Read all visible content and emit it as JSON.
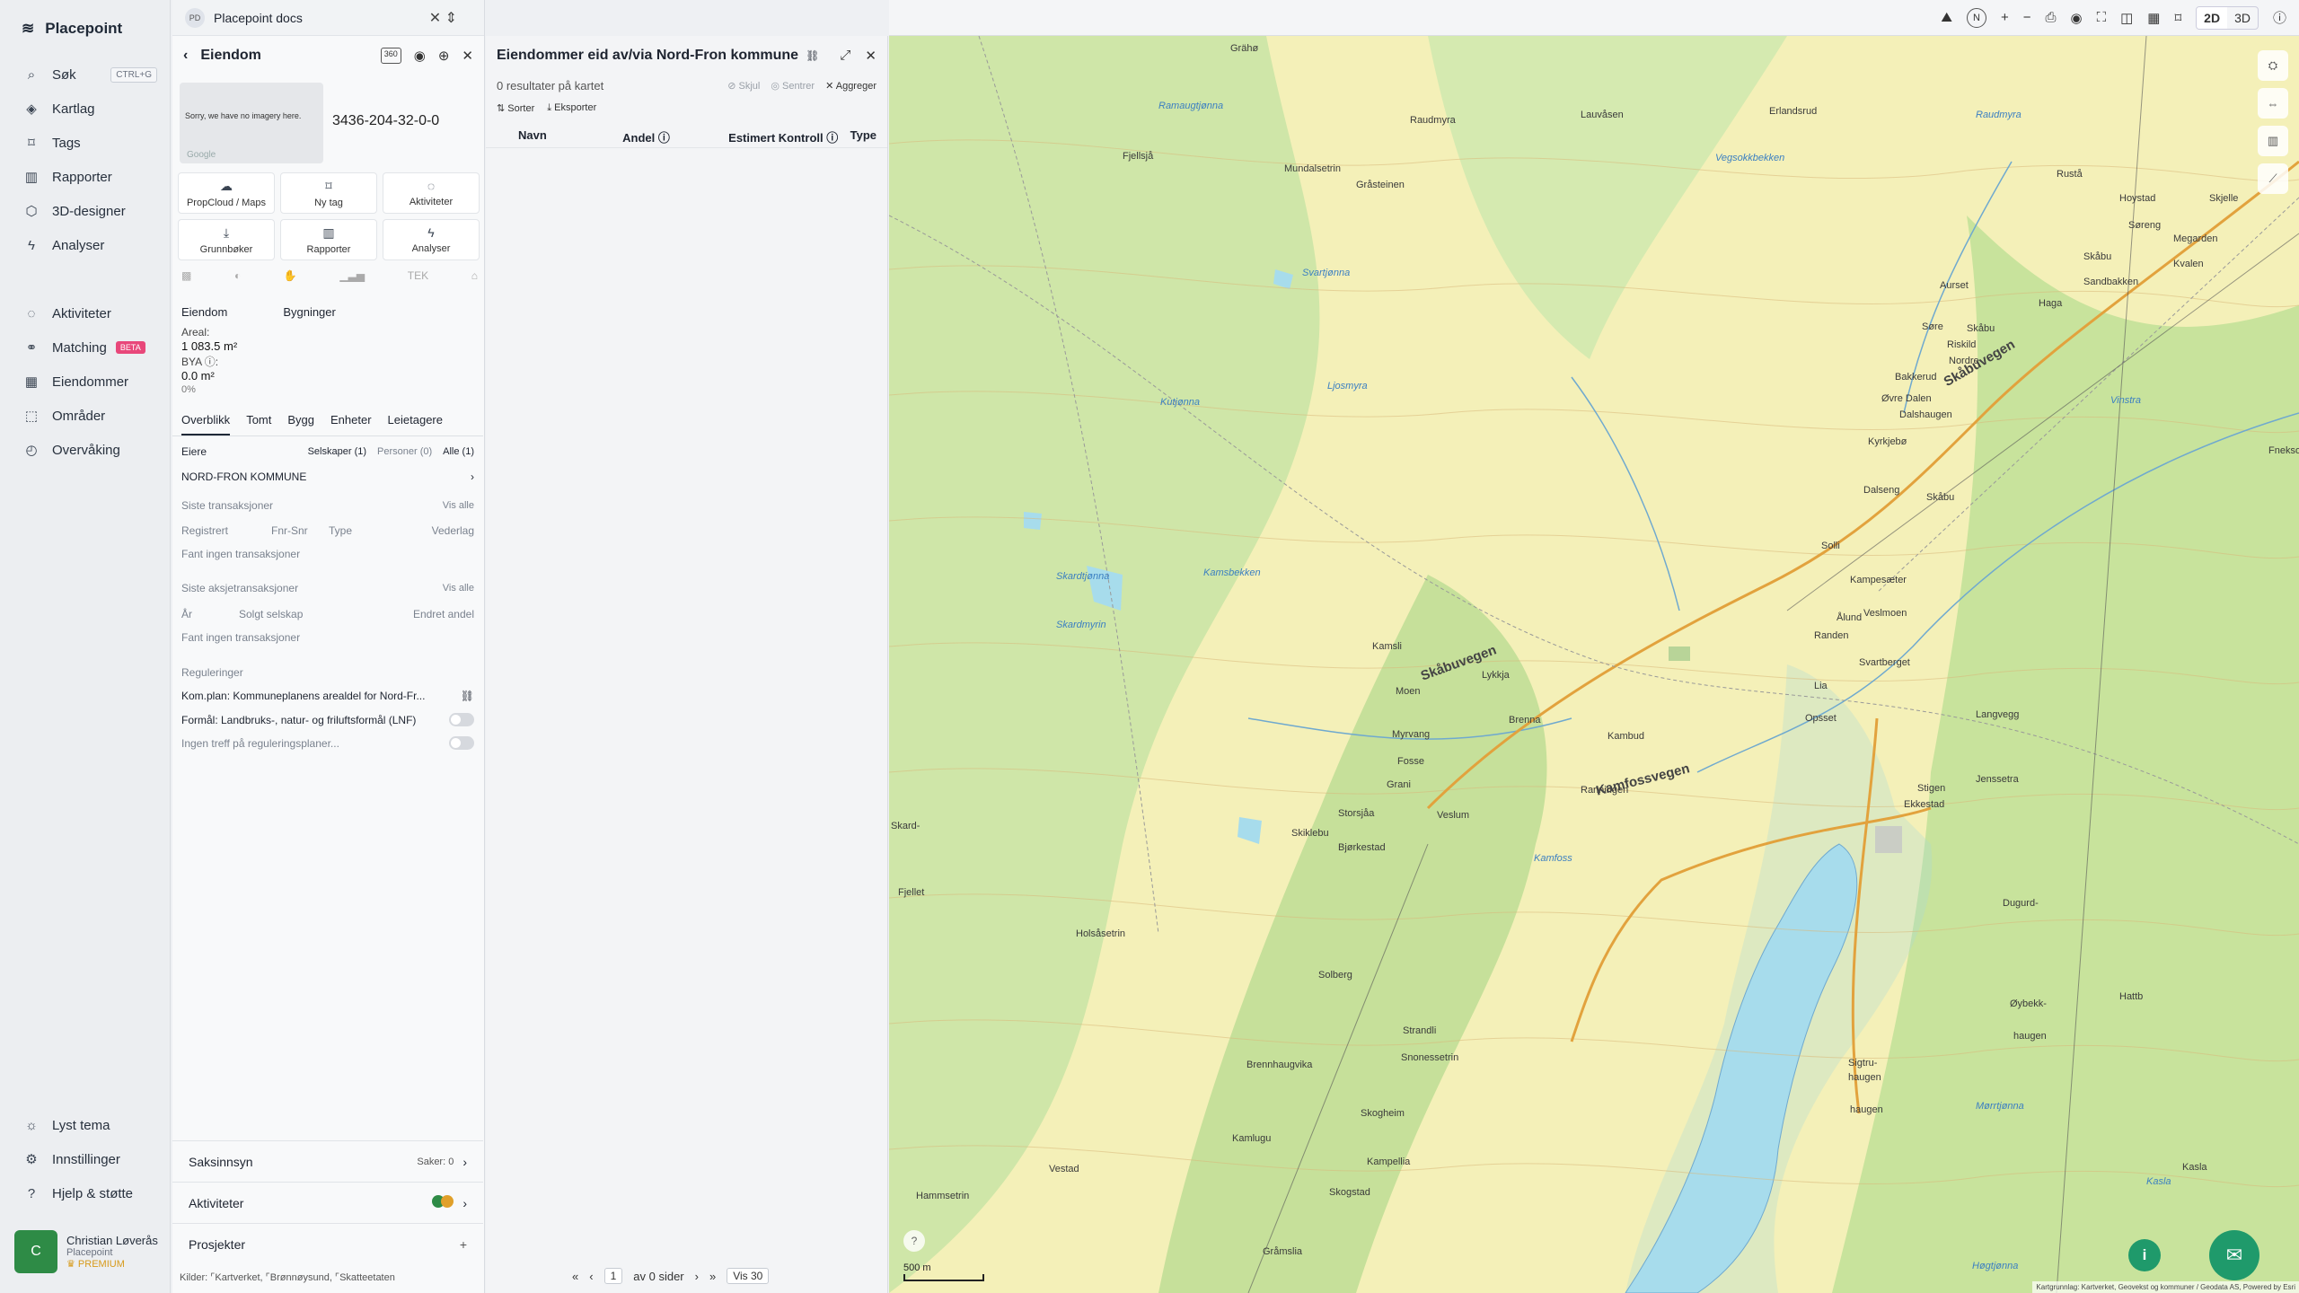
{
  "app": {
    "name": "Placepoint"
  },
  "sidebar": {
    "search": {
      "label": "Søk",
      "shortcut": "CTRL+G"
    },
    "items": [
      {
        "label": "Kartlag",
        "icon": "layers-icon"
      },
      {
        "label": "Tags",
        "icon": "bookmark-icon"
      },
      {
        "label": "Rapporter",
        "icon": "chart-icon"
      },
      {
        "label": "3D-designer",
        "icon": "cube-icon"
      },
      {
        "label": "Analyser",
        "icon": "bolt-icon"
      }
    ],
    "items2": [
      {
        "label": "Aktiviteter"
      },
      {
        "label": "Matching",
        "badge": "BETA"
      },
      {
        "label": "Eiendommer"
      },
      {
        "label": "Områder"
      },
      {
        "label": "Overvåking"
      }
    ],
    "bottom": [
      {
        "label": "Lyst tema"
      },
      {
        "label": "Innstillinger"
      },
      {
        "label": "Hjelp & støtte"
      }
    ],
    "user": {
      "initial": "C",
      "name": "Christian Løverås",
      "org": "Placepoint",
      "plan": "PREMIUM"
    }
  },
  "docs": {
    "badge": "PD",
    "title": "Placepoint docs"
  },
  "property": {
    "header": "Eiendom",
    "badge_360": "360",
    "thumb_text": "Sorry, we have no imagery here.",
    "thumb_brand": "Google",
    "id": "3436-204-32-0-0",
    "tiles": [
      {
        "label": "PropCloud / Maps"
      },
      {
        "label": "Ny tag"
      },
      {
        "label": "Aktiviteter"
      },
      {
        "label": "Grunnbøker"
      },
      {
        "label": "Rapporter"
      },
      {
        "label": "Analyser"
      }
    ],
    "col_a": "Eiendom",
    "col_b": "Bygninger",
    "areal_label": "Areal:",
    "areal_value": "1 083.5 m²",
    "bya_label": "BYA ⓘ:",
    "bya_value": "0.0 m²",
    "bya_pct": "0%",
    "tabs": [
      "Overblikk",
      "Tomt",
      "Bygg",
      "Enheter",
      "Leietagere"
    ],
    "owners": {
      "label": "Eiere",
      "companies": "Selskaper (1)",
      "persons": "Personer (0)",
      "all": "Alle (1)",
      "owner": "NORD-FRON KOMMUNE"
    },
    "tx": {
      "title": "Siste transaksjoner",
      "see_all": "Vis alle",
      "cols": [
        "Registrert",
        "Fnr-Snr",
        "Type",
        "Vederlag"
      ],
      "empty": "Fant ingen transaksjoner"
    },
    "stx": {
      "title": "Siste aksjetransaksjoner",
      "see_all": "Vis alle",
      "cols": [
        "År",
        "Solgt selskap",
        "Endret andel"
      ],
      "empty": "Fant ingen transaksjoner"
    },
    "reg": {
      "title": "Reguleringer",
      "plan": "Kom.plan: Kommuneplanens arealdel for Nord-Fr...",
      "formal": "Formål: Landbruks-, natur- og friluftsformål (LNF)",
      "none": "Ingen treff på reguleringsplaner..."
    },
    "acc": [
      {
        "label": "Saksinnsyn",
        "right": "Saker: 0"
      },
      {
        "label": "Aktiviteter",
        "right": ""
      },
      {
        "label": "Prosjekter",
        "right": "+"
      }
    ],
    "kilder": "Kilder: ⌜Kartverket, ⌜Brønnøysund, ⌜Skatteetaten"
  },
  "list": {
    "title": "Eiendommer eid av/via Nord-Fron kommune",
    "results": "0 resultater på kartet",
    "actions": [
      "Skjul",
      "Sentrer",
      "Aggreger"
    ],
    "sort": "Sorter",
    "export": "Eksporter",
    "cols": [
      "Navn",
      "Andel ⓘ",
      "Estimert Kontroll ⓘ",
      "Type"
    ],
    "pager": {
      "page": "1",
      "of": "av 0 sider",
      "show": "Vis 30"
    }
  },
  "topbar": {
    "d2": "2D",
    "d3": "3D"
  },
  "map": {
    "scale": "500 m",
    "attribution": "Kartgrunnlag: Kartverket, Geovekst og kommuner / Geodata AS, Powered by Esri",
    "places": [
      "Grähø",
      "Lauvåsen",
      "Erlandsrud",
      "Raudmyra",
      "Rustå",
      "Mundalsetrin",
      "Fjellsjå",
      "Gråsteinen",
      "Hoystad",
      "Skjelle",
      "Søreng",
      "Megarden",
      "Skåbu",
      "Kvalen",
      "Sandbakken",
      "Aurset",
      "Haga",
      "Skåbu",
      "Søre",
      "Riskild",
      "Nordre",
      "Bakkerud",
      "Øvre Dalen",
      "Dalshaugen",
      "Kyrkjebø",
      "Dalseng",
      "Skåbu",
      "Solli",
      "Ålund",
      "Kampesæter",
      "Veslmoen",
      "Kamsli",
      "Lykkja",
      "Moen",
      "Brenna",
      "Kambud",
      "Lia",
      "Opsset",
      "Myrvang",
      "Fosse",
      "Grani",
      "Ranningen",
      "Randen",
      "Svartberget",
      "Langvegg",
      "Jenssetra",
      "Stigen",
      "Ekkestad",
      "Storsjåa",
      "Skiklebu",
      "Bjørkestad",
      "Veslum",
      "Skard-",
      "Fjellet",
      "Holsåsetrin",
      "Solberg",
      "Strandli",
      "Snonessetrin",
      "Brennhaugvika",
      "Skogheim",
      "Kamlugu",
      "Kampellia",
      "Skogstad",
      "Vestad",
      "Hammsetrin",
      "Gråmslia",
      "Dugurd-",
      "Øybekk-",
      "haugen",
      "Sigtru-",
      "haugen",
      "haugen",
      "Hattb",
      "Kasla",
      "Fnekso"
    ],
    "waters": [
      "Ramaugtjønna",
      "Raudmyra",
      "Vegsokkbekken",
      "Svartjønna",
      "Kutjønna",
      "Ljosmyra",
      "Kamsbekken",
      "Skardtjønna",
      "Skardmyrin",
      "Kamfoss",
      "Mørrtjønna",
      "Vinstra",
      "Kasla",
      "Høgtjønna"
    ],
    "roads": [
      "Skåbuvegen",
      "Skåbuvegen",
      "Kamfossvegen"
    ]
  }
}
